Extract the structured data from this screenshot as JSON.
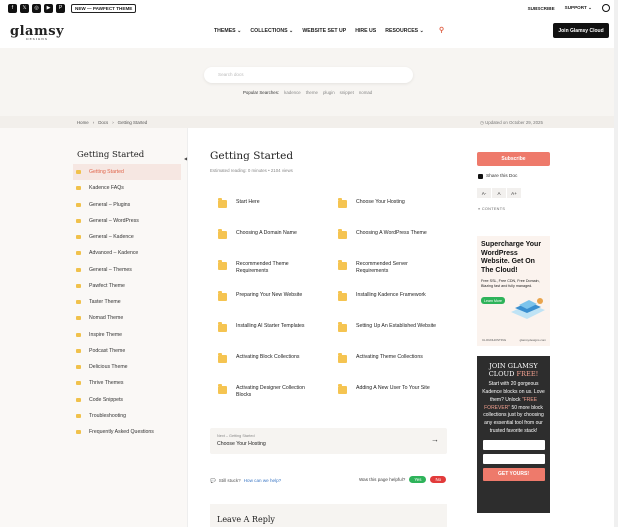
{
  "topbar": {
    "social_icons": [
      "facebook-icon",
      "x-icon",
      "instagram-icon",
      "youtube-icon",
      "pinterest-icon"
    ],
    "new_pill": "NEW — PAWFECT THEME",
    "subscribe": "SUBSCRIBE",
    "support": "SUPPORT",
    "support_chevron": "⌄"
  },
  "header": {
    "logo": "glamsy",
    "logo_sub": "DESIGNS",
    "nav": [
      "THEMES",
      "COLLECTIONS",
      "WEBSITE SET UP",
      "HIRE US",
      "RESOURCES"
    ],
    "nav_dropdown": [
      true,
      true,
      false,
      false,
      true
    ],
    "join_button": "Join Glamsy Cloud"
  },
  "hero": {
    "search_placeholder": "Search docs",
    "popular_label": "Popular Searches:",
    "popular_tags": [
      "kadence",
      "theme",
      "plugin",
      "snippet",
      "nomad"
    ]
  },
  "breadcrumb": {
    "items": [
      "Home",
      "Docs",
      "Getting Started"
    ],
    "separator": "›",
    "updated": "Updated on October 29, 2025"
  },
  "sidebar": {
    "title": "Getting Started",
    "items": [
      "Getting Started",
      "Kadence FAQs",
      "General – Plugins",
      "General – WordPress",
      "General – Kadence",
      "Advanced – Kadence",
      "General – Themes",
      "Pawfect Theme",
      "Taster Theme",
      "Nomad Theme",
      "Inspire Theme",
      "Podcast Theme",
      "Delicious Theme",
      "Thrive Themes",
      "Code Snippets",
      "Troubleshooting",
      "Frequently Asked Questions"
    ],
    "active_index": 0
  },
  "main": {
    "title": "Getting Started",
    "meta": "Estimated reading: 0 minutes  •  2104 views",
    "docs": [
      "Start Here",
      "Choose Your Hosting",
      "Choosing A Domain Name",
      "Choosing A WordPress Theme",
      "Recommended Theme Requirements",
      "Recommended Server Requirements",
      "Preparing Your New Website",
      "Installing Kadence Framework",
      "Installing AI Starter Templates",
      "Setting Up An Established Website",
      "Activating Block Collections",
      "Activating Theme Collections",
      "Activating Designer Collection Blocks",
      "Adding A New User To Your Site"
    ],
    "next_label": "Next – Getting Started",
    "next_title": "Choose Your Hosting",
    "next_arrow": "→",
    "stuck_text": "Still stuck?",
    "help_link": "How can we help?",
    "helpful_text": "Was this page helpful?",
    "yes": "Yes",
    "no": "No",
    "reply_title": "Leave A Reply"
  },
  "right": {
    "subscribe": "Subscribe",
    "share": "Share this Doc",
    "font_controls": [
      "A-",
      "A",
      "A+"
    ],
    "contents": "CONTENTS",
    "ad_heading": "Supercharge Your WordPress Website. Get On The Cloud!",
    "ad_sub": "Free SSL, Free CDN, Free Domain, Blazing fast and fully managed.",
    "ad_button": "Learn More",
    "ad_footer_left": "CLOUDHOSTING",
    "ad_footer_right": "glamsydesigns.com",
    "cloud_heading": "JOIN GLAMSY CLOUD",
    "cloud_free": "FREE!",
    "cloud_text_1": "Start with 20 gorgeous Kadence blocks on us. Love them? Unlock",
    "cloud_forever": "\"FREE FOREVER\"",
    "cloud_text_2": "50 more block collections just by choosing any essential tool from our trusted favorite stack!",
    "cloud_button": "GET YOURS!"
  },
  "colors": {
    "accent": "#ee7a6b",
    "dark": "#2d2d2d",
    "folder": "#f5c451",
    "green": "#2eb35a",
    "red": "#e23b3b"
  }
}
